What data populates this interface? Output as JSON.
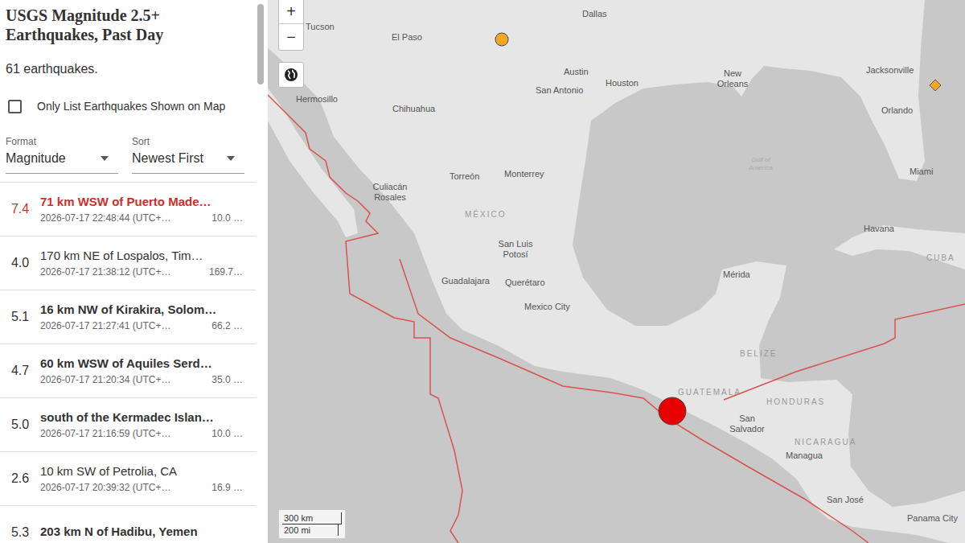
{
  "sidebar": {
    "title": "USGS Magnitude 2.5+ Earthquakes, Past Day",
    "count": "61 earthquakes.",
    "filter": {
      "label": "Only List Earthquakes Shown on Map",
      "checked": false
    },
    "format": {
      "label": "Format",
      "value": "Magnitude"
    },
    "sort": {
      "label": "Sort",
      "value": "Newest First"
    }
  },
  "earthquakes": [
    {
      "magnitude": "7.4",
      "place": "71 km WSW of Puerto Made…",
      "time": "2026-07-17 22:48:44 (UTC+…",
      "depth": "10.0 …",
      "selected": true,
      "bold": true
    },
    {
      "magnitude": "4.0",
      "place": "170 km NE of Lospalos, Tim…",
      "time": "2026-07-17 21:38:12 (UTC+…",
      "depth": "169.7…",
      "selected": false,
      "bold": false
    },
    {
      "magnitude": "5.1",
      "place": "16 km NW of Kirakira, Solom…",
      "time": "2026-07-17 21:27:41 (UTC+…",
      "depth": "66.2 …",
      "selected": false,
      "bold": true
    },
    {
      "magnitude": "4.7",
      "place": "60 km WSW of Aquiles Serd…",
      "time": "2026-07-17 21:20:34 (UTC+…",
      "depth": "35.0 …",
      "selected": false,
      "bold": true
    },
    {
      "magnitude": "5.0",
      "place": "south of the Kermadec Islan…",
      "time": "2026-07-17 21:16:59 (UTC+…",
      "depth": "10.0 …",
      "selected": false,
      "bold": true
    },
    {
      "magnitude": "2.6",
      "place": "10 km SW of Petrolia, CA",
      "time": "2026-07-17 20:39:32 (UTC+…",
      "depth": "16.9 …",
      "selected": false,
      "bold": false
    },
    {
      "magnitude": "5.3",
      "place": "203 km N of Hadibu, Yemen",
      "time": "",
      "depth": "",
      "selected": false,
      "bold": true
    }
  ],
  "map": {
    "zoom_in": "+",
    "zoom_out": "−",
    "labels": [
      {
        "text": "Tucson",
        "kind": "city"
      },
      {
        "text": "El Paso",
        "kind": "city"
      },
      {
        "text": "Dallas",
        "kind": "city"
      },
      {
        "text": "Austin",
        "kind": "city"
      },
      {
        "text": "Houston",
        "kind": "city"
      },
      {
        "text": "San Antonio",
        "kind": "city"
      },
      {
        "text": "New Orleans",
        "kind": "city"
      },
      {
        "text": "Jacksonville",
        "kind": "city"
      },
      {
        "text": "Orlando",
        "kind": "city"
      },
      {
        "text": "Miami",
        "kind": "city"
      },
      {
        "text": "Hermosillo",
        "kind": "city"
      },
      {
        "text": "Chihuahua",
        "kind": "city"
      },
      {
        "text": "Culiacán Rosales",
        "kind": "city"
      },
      {
        "text": "Torreón",
        "kind": "city"
      },
      {
        "text": "Monterrey",
        "kind": "city"
      },
      {
        "text": "MÉXICO",
        "kind": "country"
      },
      {
        "text": "San Luis Potosí",
        "kind": "city"
      },
      {
        "text": "Guadalajara",
        "kind": "city"
      },
      {
        "text": "Querétaro",
        "kind": "city"
      },
      {
        "text": "Mexico City",
        "kind": "city"
      },
      {
        "text": "Mérida",
        "kind": "city"
      },
      {
        "text": "Havana",
        "kind": "city"
      },
      {
        "text": "CUBA",
        "kind": "country"
      },
      {
        "text": "Gulf of America",
        "kind": "water"
      },
      {
        "text": "BELIZE",
        "kind": "country"
      },
      {
        "text": "GUATEMALA",
        "kind": "country"
      },
      {
        "text": "HONDURAS",
        "kind": "country"
      },
      {
        "text": "San Salvador",
        "kind": "city"
      },
      {
        "text": "NICARAGUA",
        "kind": "country"
      },
      {
        "text": "Managua",
        "kind": "city"
      },
      {
        "text": "San José",
        "kind": "city"
      },
      {
        "text": "Panama City",
        "kind": "city"
      }
    ],
    "markers": [
      {
        "kind": "circle",
        "color": "#e60000"
      },
      {
        "kind": "circle",
        "color": "#f5a623"
      },
      {
        "kind": "diamond",
        "color": "#f5a623"
      }
    ],
    "scale": {
      "metric": "300 km",
      "imperial": "200 mi"
    }
  }
}
